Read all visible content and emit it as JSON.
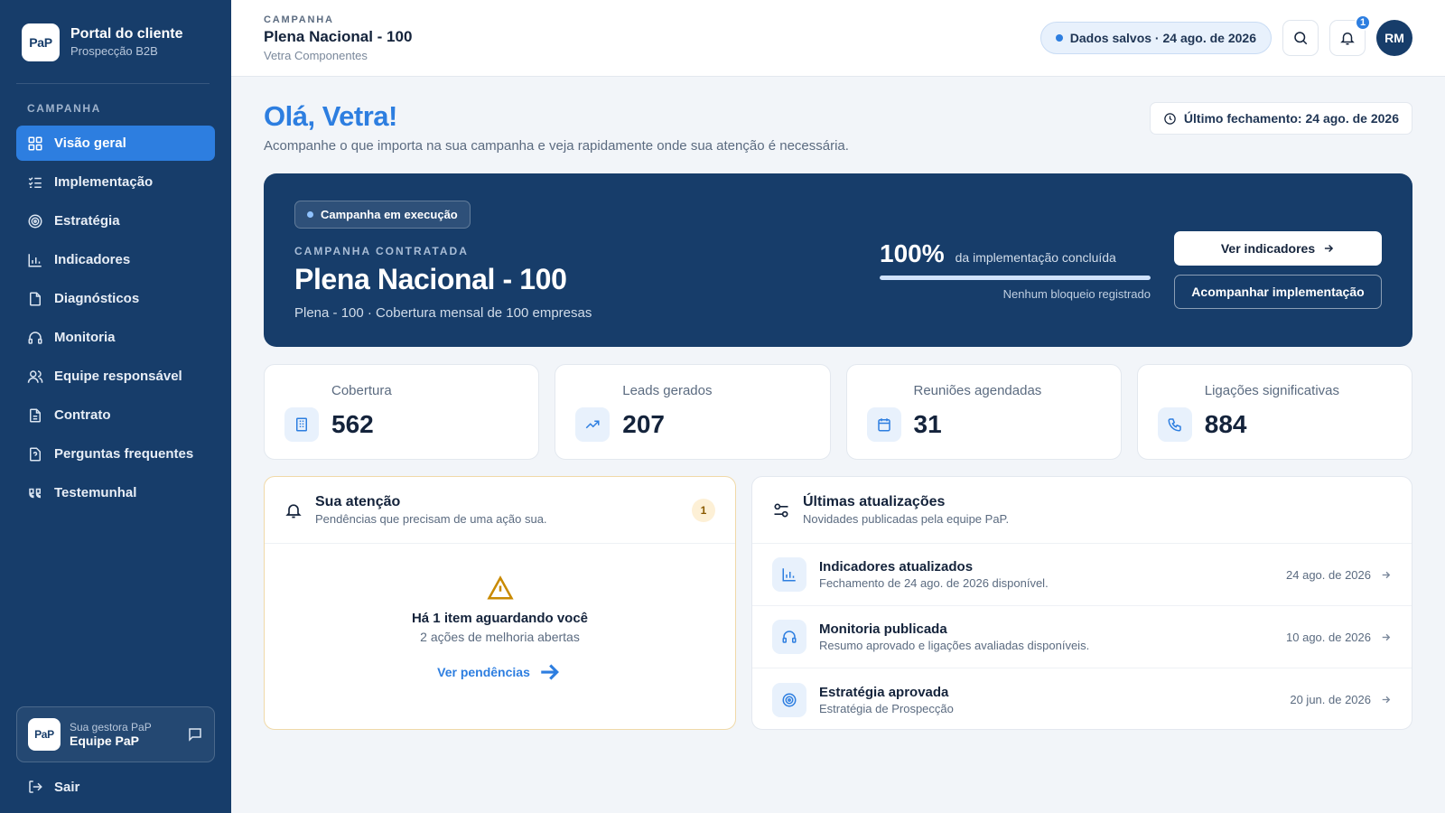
{
  "brand": {
    "logo": "PaP",
    "title": "Portal do cliente",
    "subtitle": "Prospecção B2B"
  },
  "sidebar": {
    "section_label": "CAMPANHA",
    "items": [
      {
        "label": "Visão geral",
        "icon": "grid-icon",
        "active": true
      },
      {
        "label": "Implementação",
        "icon": "checklist-icon"
      },
      {
        "label": "Estratégia",
        "icon": "target-icon"
      },
      {
        "label": "Indicadores",
        "icon": "bar-chart-icon"
      },
      {
        "label": "Diagnósticos",
        "icon": "document-icon"
      },
      {
        "label": "Monitoria",
        "icon": "headphones-icon"
      },
      {
        "label": "Equipe responsável",
        "icon": "users-icon"
      },
      {
        "label": "Contrato",
        "icon": "contract-icon"
      },
      {
        "label": "Perguntas frequentes",
        "icon": "faq-icon"
      },
      {
        "label": "Testemunhal",
        "icon": "quote-icon"
      }
    ],
    "gestora": {
      "logo": "PaP",
      "label": "Sua gestora PaP",
      "name": "Equipe PaP"
    },
    "logout": "Sair"
  },
  "topbar": {
    "label": "CAMPANHA",
    "title": "Plena Nacional - 100",
    "company": "Vetra Componentes",
    "saved": "Dados salvos · 24 ago. de 2026",
    "notification_count": "1",
    "avatar": "RM"
  },
  "greeting": {
    "title": "Olá, Vetra!",
    "subtitle": "Acompanhe o que importa na sua campanha e veja rapidamente onde sua atenção é necessária.",
    "closing": "Último fechamento: 24 ago. de 2026"
  },
  "hero": {
    "status": "Campanha em execução",
    "label": "CAMPANHA CONTRATADA",
    "title": "Plena Nacional - 100",
    "subtitle": "Plena - 100 · Cobertura mensal de 100 empresas",
    "percent": "100%",
    "percent_label": "da implementação concluída",
    "progress": 1.0,
    "note": "Nenhum bloqueio registrado",
    "primary_button": "Ver indicadores",
    "secondary_button": "Acompanhar implementação"
  },
  "stats": [
    {
      "label": "Cobertura",
      "value": "562",
      "icon": "building-icon"
    },
    {
      "label": "Leads gerados",
      "value": "207",
      "icon": "trend-up-icon"
    },
    {
      "label": "Reuniões agendadas",
      "value": "31",
      "icon": "calendar-icon"
    },
    {
      "label": "Ligações significativas",
      "value": "884",
      "icon": "phone-icon"
    }
  ],
  "attention": {
    "title": "Sua atenção",
    "subtitle": "Pendências que precisam de uma ação sua.",
    "count": "1",
    "body_title": "Há 1 item aguardando você",
    "body_sub": "2 ações de melhoria abertas",
    "link": "Ver pendências"
  },
  "updates": {
    "title": "Últimas atualizações",
    "subtitle": "Novidades publicadas pela equipe PaP.",
    "items": [
      {
        "title": "Indicadores atualizados",
        "subtitle": "Fechamento de 24 ago. de 2026 disponível.",
        "date": "24 ago. de 2026",
        "icon": "bar-chart-icon"
      },
      {
        "title": "Monitoria publicada",
        "subtitle": "Resumo aprovado e ligações avaliadas disponíveis.",
        "date": "10 ago. de 2026",
        "icon": "headphones-icon"
      },
      {
        "title": "Estratégia aprovada",
        "subtitle": "Estratégia de Prospecção",
        "date": "20 jun. de 2026",
        "icon": "target-icon"
      }
    ]
  },
  "colors": {
    "sidebar": "#173d6a",
    "accent": "#2d7ee0",
    "warning": "#c98a00"
  }
}
